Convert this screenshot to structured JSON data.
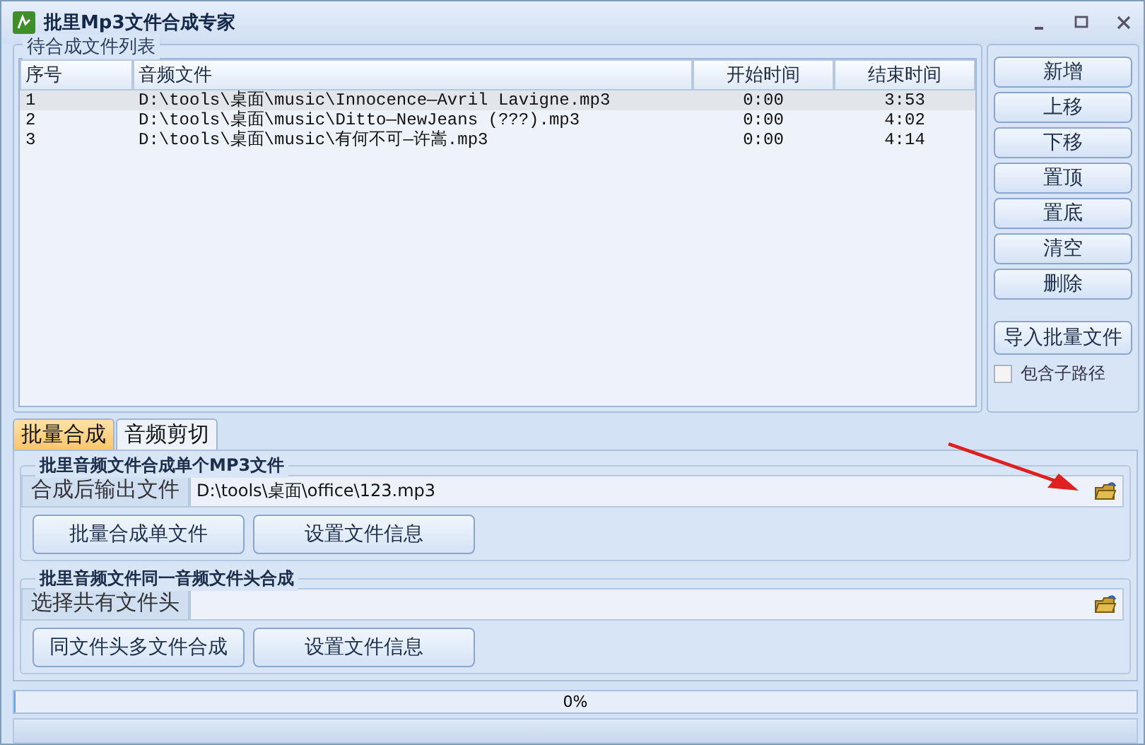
{
  "window": {
    "title": "批里Mp3文件合成专家"
  },
  "file_list": {
    "title": "待合成文件列表",
    "columns": [
      "序号",
      "音频文件",
      "开始时间",
      "结束时间"
    ],
    "rows": [
      {
        "cells": [
          "1",
          "D:\\tools\\桌面\\music\\Innocence—Avril Lavigne.mp3",
          "0:00",
          "3:53"
        ],
        "selected": true
      },
      {
        "cells": [
          "2",
          "D:\\tools\\桌面\\music\\Ditto—NewJeans (???).mp3",
          "0:00",
          "4:02"
        ],
        "selected": false
      },
      {
        "cells": [
          "3",
          "D:\\tools\\桌面\\music\\有何不可—许嵩.mp3",
          "0:00",
          "4:14"
        ],
        "selected": false
      }
    ]
  },
  "side_buttons": [
    "新增",
    "上移",
    "下移",
    "置顶",
    "置底",
    "清空",
    "删除"
  ],
  "import_button": "导入批量文件",
  "include_subpaths": {
    "label": "包含子路径",
    "checked": false
  },
  "tabs": [
    {
      "label": "批量合成",
      "selected": true
    },
    {
      "label": "音频剪切",
      "selected": false
    }
  ],
  "groups": [
    {
      "title": "批里音频文件合成单个MP3文件",
      "field_label": "合成后输出文件",
      "value": "D:\\tools\\桌面\\office\\123.mp3",
      "buttons": [
        "批量合成单文件",
        "设置文件信息"
      ]
    },
    {
      "title": "批里音频文件同一音频文件头合成",
      "field_label": "选择共有文件头",
      "buttons": [
        "同文件头多文件合成",
        "设置文件信息"
      ]
    }
  ],
  "progress": {
    "label": "0%",
    "level": 0
  }
}
